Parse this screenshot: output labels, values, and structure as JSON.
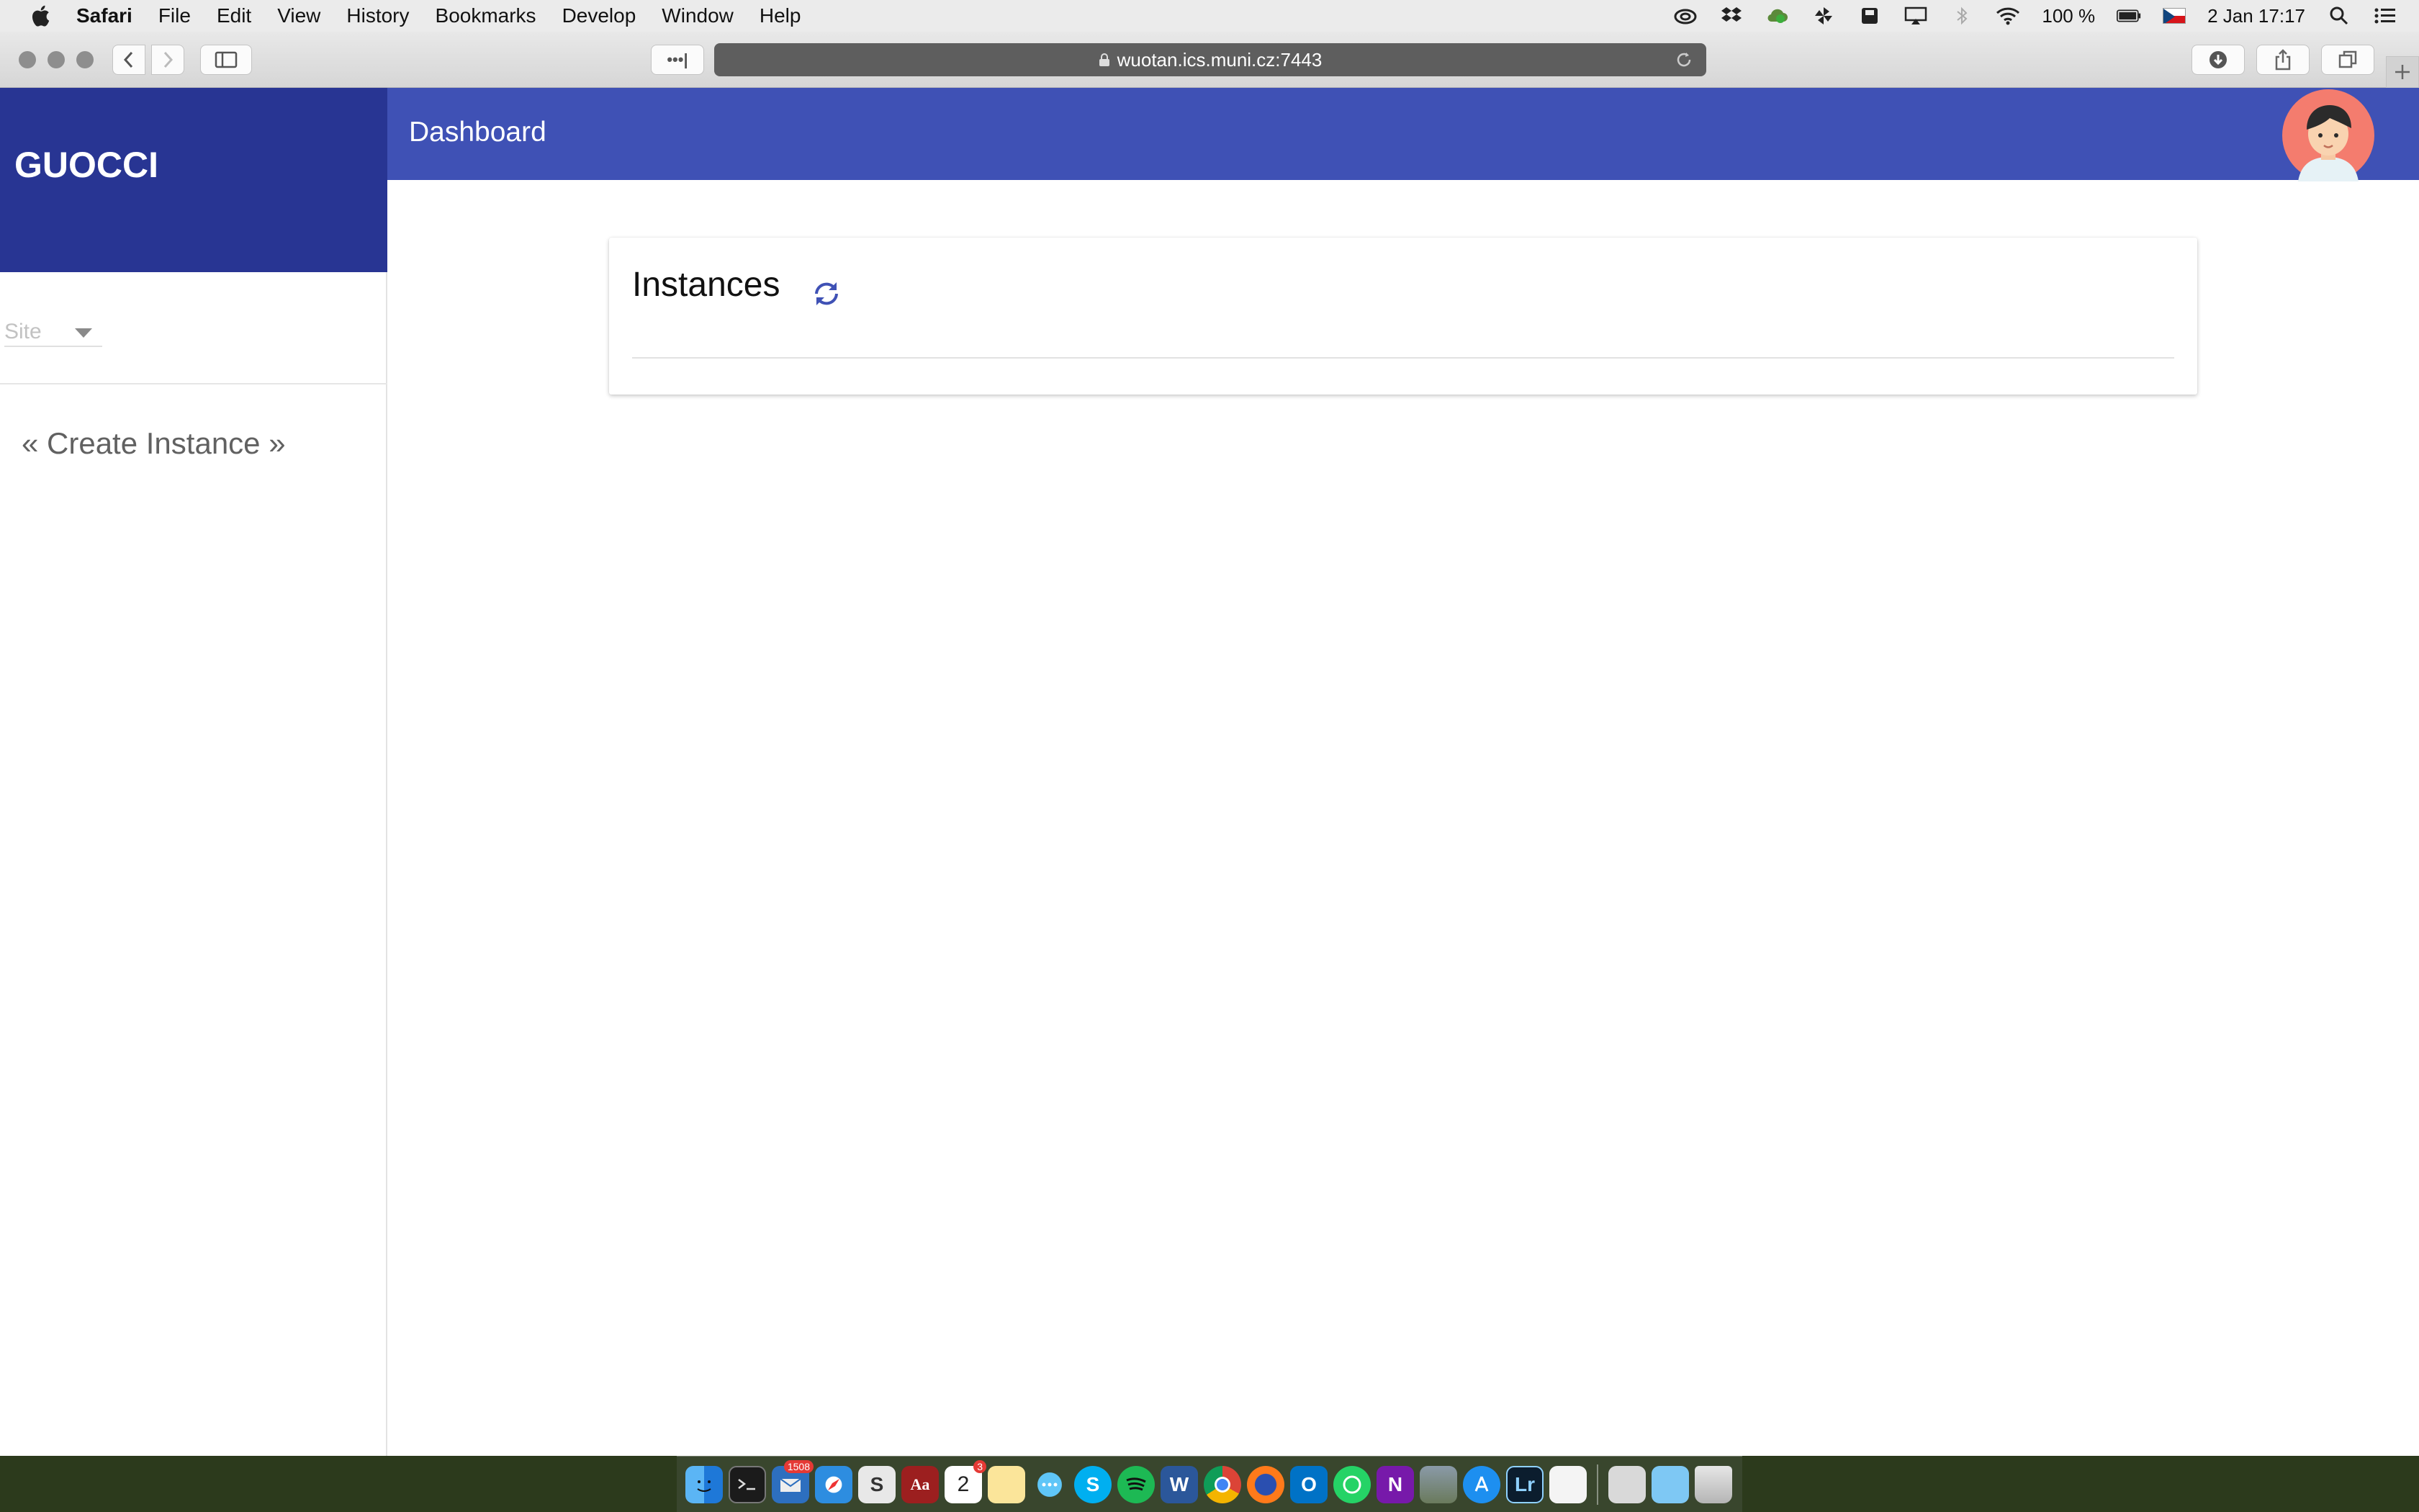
{
  "menubar": {
    "app": "Safari",
    "items": [
      "File",
      "Edit",
      "View",
      "History",
      "Bookmarks",
      "Develop",
      "Window",
      "Help"
    ],
    "battery": "100 %",
    "datetime": "2 Jan  17:17"
  },
  "browser": {
    "url": "wuotan.ics.muni.cz:7443",
    "more_label": "•••|"
  },
  "app": {
    "brand": "GUOCCI",
    "header_title": "Dashboard",
    "site_placeholder": "Site",
    "create_link": "« Create Instance »",
    "card_title": "Instances"
  },
  "dock": {
    "badges": {
      "thunderbird": "1508",
      "calendar_day": "2",
      "calendar_badge": "3"
    },
    "labels": {
      "lightroom": "Lr",
      "word": "W",
      "outlook": "O",
      "onenote": "N",
      "dictionary": "Aa",
      "slack": "S",
      "skype": "S"
    }
  },
  "colors": {
    "brand_dark": "#283593",
    "brand": "#3f51b5",
    "link": "#616161"
  }
}
